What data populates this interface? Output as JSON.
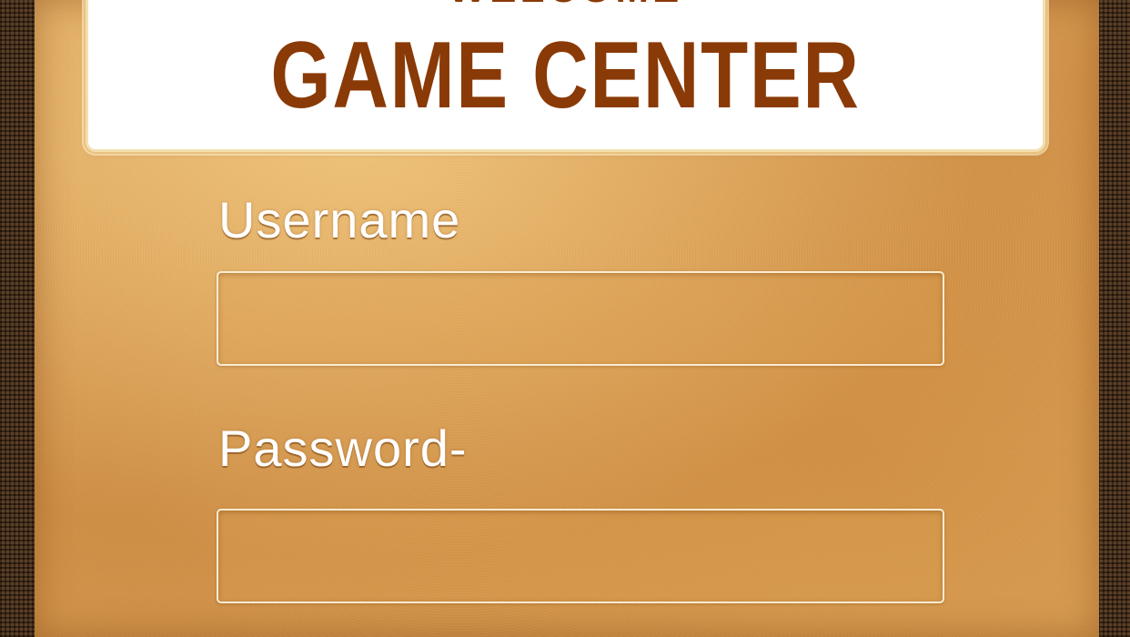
{
  "header": {
    "welcome": "WELCOME",
    "title": "GAME CENTER"
  },
  "form": {
    "username_label": "Username",
    "username_value": "",
    "password_label": "Password-",
    "password_value": ""
  },
  "colors": {
    "title_text": "#8a3a06",
    "parchment": "#dba257",
    "frame": "#4a2d14",
    "label_text": "#ffffff"
  }
}
